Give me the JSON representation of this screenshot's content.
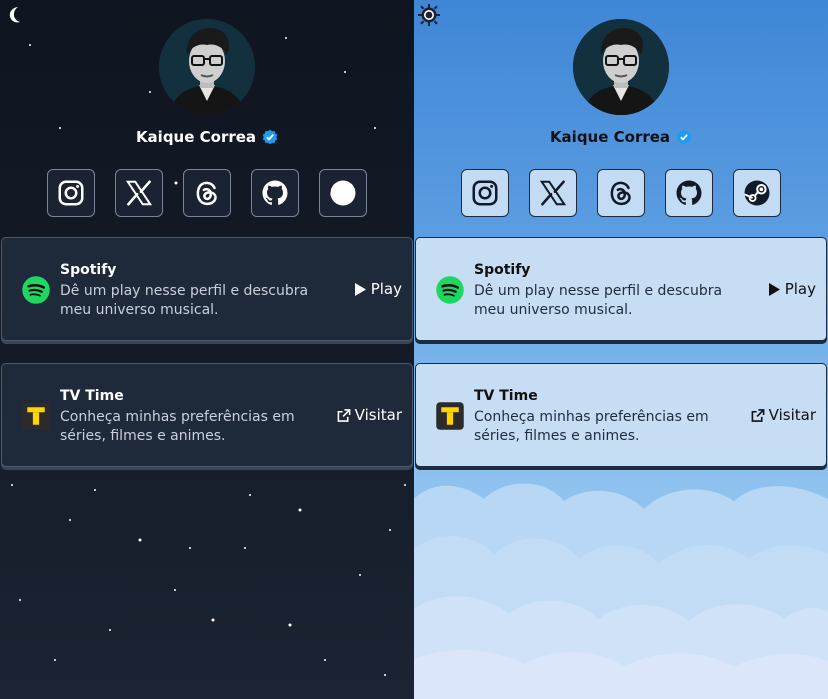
{
  "colors": {
    "dark_bg": "#141b27",
    "light_bg": "#5c9ee2",
    "verified": "#1d9bf0",
    "spotify": "#1ed760",
    "tvtime": "#ffd400"
  },
  "panes": [
    {
      "theme": "dark",
      "toggle_icon": "moon-icon",
      "profile": {
        "name": "Kaique Correa"
      },
      "socials": [
        {
          "icon": "instagram-icon"
        },
        {
          "icon": "x-icon"
        },
        {
          "icon": "threads-icon"
        },
        {
          "icon": "github-icon"
        },
        {
          "icon": "steam-icon"
        }
      ],
      "cards": [
        {
          "title": "Spotify",
          "desc": "Dê um play nesse perfil e descubra meu universo musical.",
          "action": "Play",
          "icon": "spotify-icon",
          "action_icon": "play-icon"
        },
        {
          "title": "TV Time",
          "desc": "Conheça minhas preferências em séries, filmes e animes.",
          "action": "Visitar",
          "icon": "tvtime-icon",
          "action_icon": "external-link-icon"
        }
      ]
    },
    {
      "theme": "light",
      "toggle_icon": "sun-icon",
      "profile": {
        "name": "Kaique Correa"
      },
      "socials": [
        {
          "icon": "instagram-icon"
        },
        {
          "icon": "x-icon"
        },
        {
          "icon": "threads-icon"
        },
        {
          "icon": "github-icon"
        },
        {
          "icon": "steam-icon"
        }
      ],
      "cards": [
        {
          "title": "Spotify",
          "desc": "Dê um play nesse perfil e descubra meu universo musical.",
          "action": "Play",
          "icon": "spotify-icon",
          "action_icon": "play-icon"
        },
        {
          "title": "TV Time",
          "desc": "Conheça minhas preferências em séries, filmes e animes.",
          "action": "Visitar",
          "icon": "tvtime-icon",
          "action_icon": "external-link-icon"
        }
      ]
    }
  ]
}
